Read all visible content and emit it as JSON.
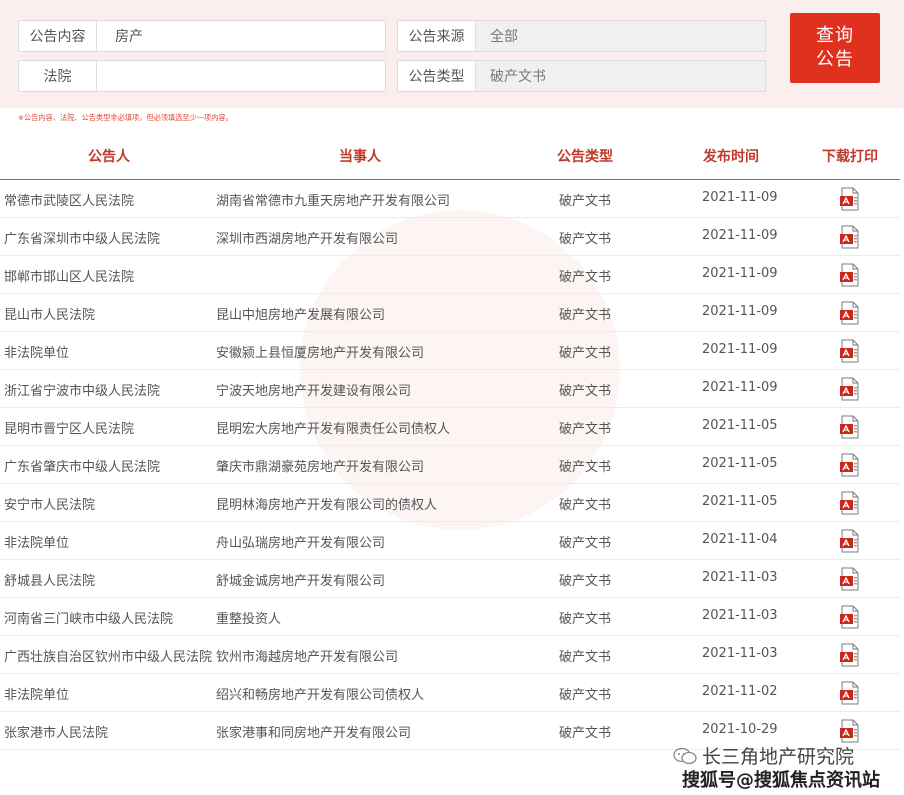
{
  "search": {
    "content_label": "公告内容",
    "content_value": "房产",
    "court_label": "法院",
    "court_value": "",
    "source_label": "公告来源",
    "source_value": "全部",
    "type_label": "公告类型",
    "type_value": "破产文书",
    "query_line1": "查询",
    "query_line2": "公告",
    "hint": "※公告内容、法院、公告类型非必填项，但必须填选至少一项内容。"
  },
  "table": {
    "headers": [
      "公告人",
      "当事人",
      "公告类型",
      "发布时间",
      "下载打印"
    ],
    "rows": [
      {
        "publisher": "常德市武陵区人民法院",
        "party": "湖南省常德市九重天房地产开发有限公司",
        "type": "破产文书",
        "date": "2021-11-09"
      },
      {
        "publisher": "广东省深圳市中级人民法院",
        "party": "深圳市西湖房地产开发有限公司",
        "type": "破产文书",
        "date": "2021-11-09"
      },
      {
        "publisher": "邯郸市邯山区人民法院",
        "party": "",
        "type": "破产文书",
        "date": "2021-11-09"
      },
      {
        "publisher": "昆山市人民法院",
        "party": "昆山中旭房地产发展有限公司",
        "type": "破产文书",
        "date": "2021-11-09"
      },
      {
        "publisher": "非法院单位",
        "party": "安徽颍上县恒厦房地产开发有限公司",
        "type": "破产文书",
        "date": "2021-11-09"
      },
      {
        "publisher": "浙江省宁波市中级人民法院",
        "party": "宁波天地房地产开发建设有限公司",
        "type": "破产文书",
        "date": "2021-11-09"
      },
      {
        "publisher": "昆明市晋宁区人民法院",
        "party": "昆明宏大房地产开发有限责任公司债权人",
        "type": "破产文书",
        "date": "2021-11-05"
      },
      {
        "publisher": "广东省肇庆市中级人民法院",
        "party": "肇庆市鼎湖豪苑房地产开发有限公司",
        "type": "破产文书",
        "date": "2021-11-05"
      },
      {
        "publisher": "安宁市人民法院",
        "party": "昆明林海房地产开发有限公司的债权人",
        "type": "破产文书",
        "date": "2021-11-05"
      },
      {
        "publisher": "非法院单位",
        "party": "舟山弘瑞房地产开发有限公司",
        "type": "破产文书",
        "date": "2021-11-04"
      },
      {
        "publisher": "舒城县人民法院",
        "party": "舒城金诚房地产开发有限公司",
        "type": "破产文书",
        "date": "2021-11-03"
      },
      {
        "publisher": "河南省三门峡市中级人民法院",
        "party": "重整投资人",
        "type": "破产文书",
        "date": "2021-11-03"
      },
      {
        "publisher": "广西壮族自治区钦州市中级人民法院",
        "party": "钦州市海越房地产开发有限公司",
        "type": "破产文书",
        "date": "2021-11-03"
      },
      {
        "publisher": "非法院单位",
        "party": "绍兴和畅房地产开发有限公司债权人",
        "type": "破产文书",
        "date": "2021-11-02"
      },
      {
        "publisher": "张家港市人民法院",
        "party": "张家港事和同房地产开发有限公司",
        "type": "破产文书",
        "date": "2021-10-29"
      }
    ]
  },
  "footer": {
    "brand_name": "长三角地产研究院",
    "watermark_text": "搜狐号@搜狐焦点资讯站"
  },
  "colors": {
    "accent": "#e0301e",
    "header_text": "#c0392b",
    "panel_bg": "#fbeeee"
  },
  "icons": {
    "download": "pdf-icon",
    "brand": "wechat-icon"
  }
}
